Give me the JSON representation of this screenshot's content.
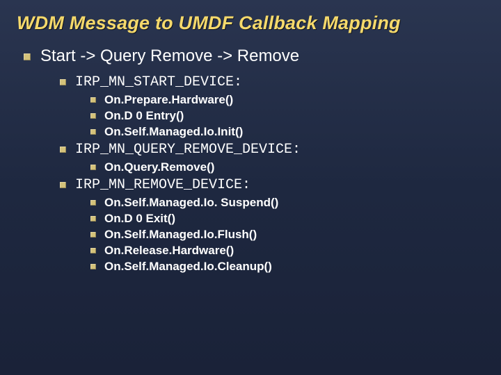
{
  "title": "WDM Message to UMDF Callback Mapping",
  "main_item": "Start -> Query Remove -> Remove",
  "sections": [
    {
      "heading": "IRP_MN_START_DEVICE:",
      "items": [
        "On.Prepare.Hardware()",
        "On.D 0 Entry()",
        "On.Self.Managed.Io.Init()"
      ]
    },
    {
      "heading": "IRP_MN_QUERY_REMOVE_DEVICE:",
      "items": [
        "On.Query.Remove()"
      ]
    },
    {
      "heading": "IRP_MN_REMOVE_DEVICE:",
      "items": [
        "On.Self.Managed.Io. Suspend()",
        "On.D 0 Exit()",
        "On.Self.Managed.Io.Flush()",
        "On.Release.Hardware()",
        "On.Self.Managed.Io.Cleanup()"
      ]
    }
  ]
}
